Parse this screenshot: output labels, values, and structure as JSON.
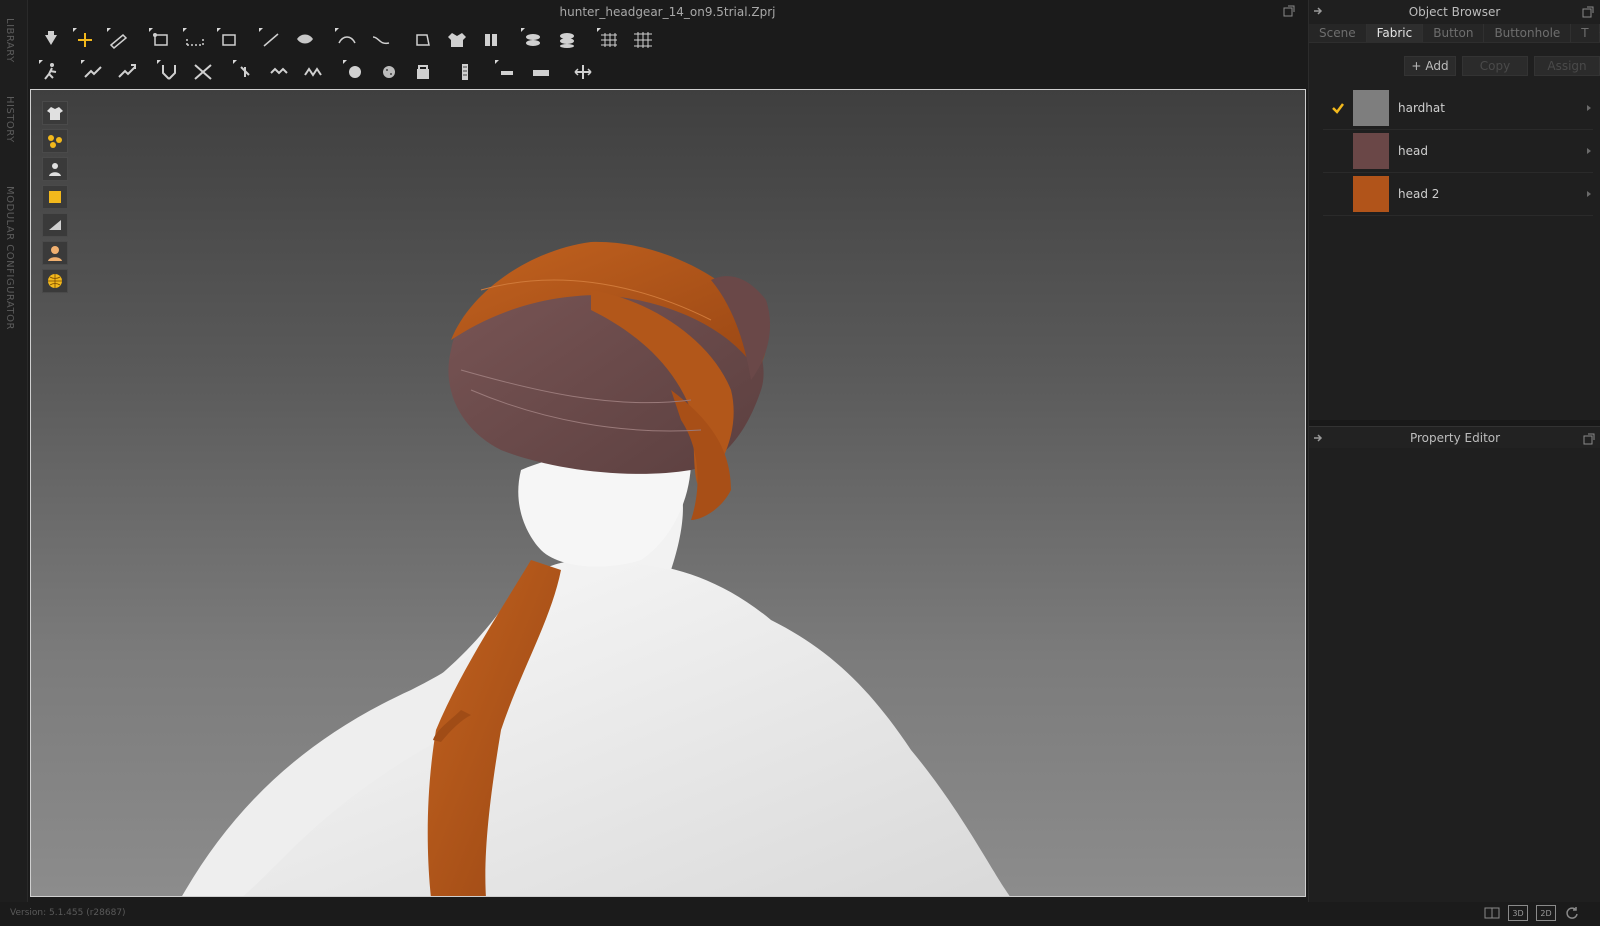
{
  "app": {
    "file_title": "hunter_headgear_14_on9.5trial.Zprj",
    "version": "Version: 5.1.455 (r28687)"
  },
  "left_rail": {
    "tabs": [
      "LIBRARY",
      "HISTORY",
      "MODULAR CONFIGURATOR"
    ]
  },
  "toolbar_top": {
    "tools": [
      "transform-pattern",
      "edit-pattern",
      "edit-point",
      "polygon",
      "rectangle",
      "circle",
      "internal-line",
      "trace",
      "segment-sew",
      "free-sew",
      "fold-arrangement",
      "arrangement-plane",
      "tack",
      "strengthen",
      "show-grid",
      "fold-grid"
    ]
  },
  "toolbar_bottom": {
    "tools": [
      "select-avatar",
      "edit-sewing",
      "segment-sewing",
      "free-sewing",
      "check-sewing",
      "pin",
      "fold-tack",
      "edit-tack",
      "button",
      "buttonhole",
      "topstitch",
      "zipper",
      "elastic",
      "measure",
      "move-tool"
    ]
  },
  "viewport": {
    "side_tools": [
      "garment-icon",
      "particle-icon",
      "avatar-icon",
      "texture-icon",
      "surface-icon",
      "skin-icon",
      "globe-icon"
    ]
  },
  "object_browser": {
    "title": "Object Browser",
    "tabs": [
      {
        "label": "Scene",
        "active": false
      },
      {
        "label": "Fabric",
        "active": true
      },
      {
        "label": "Button",
        "active": false
      },
      {
        "label": "Buttonhole",
        "active": false
      },
      {
        "label": "T",
        "active": false
      }
    ],
    "actions": {
      "add": "Add",
      "copy": "Copy",
      "assign": "Assign"
    },
    "fabrics": [
      {
        "name": "hardhat",
        "color": "#7e7e7e",
        "checked": true
      },
      {
        "name": "head",
        "color": "#6a4747",
        "checked": false
      },
      {
        "name": "head 2",
        "color": "#b1541a",
        "checked": false
      }
    ],
    "accent_color": "#f2b81c"
  },
  "property_editor": {
    "title": "Property Editor"
  },
  "view_modes": [
    "3D",
    "2D"
  ]
}
